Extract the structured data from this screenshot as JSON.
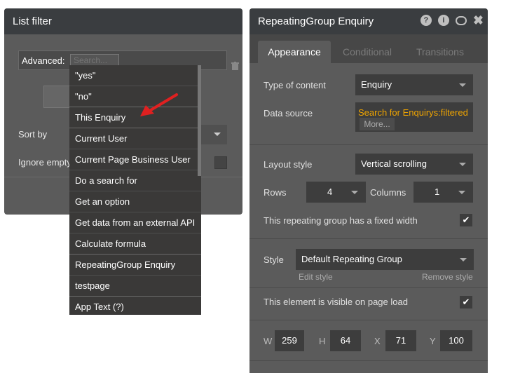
{
  "list_filter": {
    "title": "List filter",
    "advanced_label": "Advanced:",
    "search_placeholder": "Search...",
    "sort_by_label": "Sort by",
    "ignore_empty_label": "Ignore empty"
  },
  "dropdown": {
    "items": [
      "\"yes\"",
      "\"no\"",
      "This Enquiry",
      "Current User",
      "Current Page Business User",
      "Do a search for",
      "Get an option",
      "Get data from an external API",
      "Calculate formula",
      "RepeatingGroup Enquiry",
      "testpage",
      "App Text (?)"
    ]
  },
  "property_editor": {
    "title": "RepeatingGroup Enquiry",
    "icons": [
      "help-icon",
      "info-icon",
      "comment-icon",
      "close-icon"
    ],
    "help_glyph": "?",
    "info_glyph": "i",
    "close_glyph": "✖",
    "tabs": [
      "Appearance",
      "Conditional",
      "Transitions"
    ],
    "type_of_content_label": "Type of content",
    "type_of_content_value": "Enquiry",
    "data_source_label": "Data source",
    "data_source_value": "Search for Enquirys:filtered",
    "more_label": "More...",
    "layout_style_label": "Layout style",
    "layout_style_value": "Vertical scrolling",
    "rows_label": "Rows",
    "rows_value": "4",
    "columns_label": "Columns",
    "columns_value": "1",
    "fixed_width_label": "This repeating group has a fixed width",
    "fixed_width_checked": true,
    "check_glyph": "✔",
    "style_label": "Style",
    "style_value": "Default Repeating Group",
    "edit_style": "Edit style",
    "remove_style": "Remove style",
    "visible_label": "This element is visible on page load",
    "visible_checked": true,
    "w_label": "W",
    "w_value": "259",
    "h_label": "H",
    "h_value": "64",
    "x_label": "X",
    "x_value": "71",
    "y_label": "Y",
    "y_value": "100"
  },
  "colors": {
    "header_bg": "#3a3d40",
    "panel_bg": "#5b5b5b",
    "accent_orange": "#f0a500",
    "arrow_red": "#e02020"
  }
}
